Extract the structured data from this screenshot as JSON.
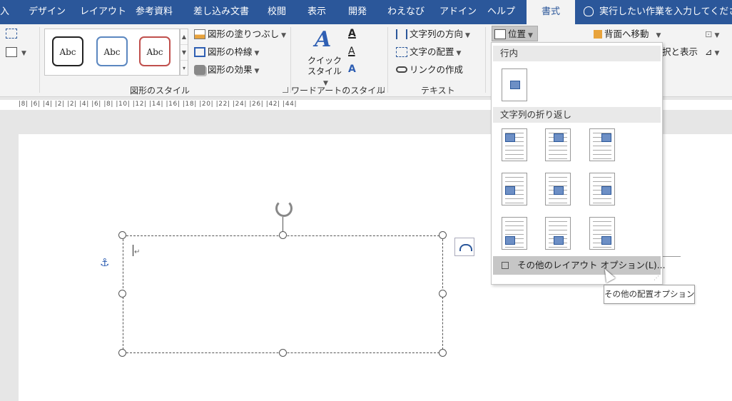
{
  "tabs": [
    {
      "label": "入"
    },
    {
      "label": "デザイン"
    },
    {
      "label": "レイアウト"
    },
    {
      "label": "参考資料"
    },
    {
      "label": "差し込み文書"
    },
    {
      "label": "校閲"
    },
    {
      "label": "表示"
    },
    {
      "label": "開発"
    },
    {
      "label": "わえなび"
    },
    {
      "label": "アドイン"
    },
    {
      "label": "ヘルプ"
    },
    {
      "label": "書式",
      "active": true
    }
  ],
  "tell_me": "実行したい作業を入力してください",
  "ribbon": {
    "shape_styles": {
      "samples": [
        "Abc",
        "Abc",
        "Abc"
      ],
      "fill": "図形の塗りつぶし",
      "outline": "図形の枠線",
      "effects": "図形の効果",
      "group_label": "図形のスタイル"
    },
    "wordart": {
      "quick_styles_line1": "クイック",
      "quick_styles_line2": "スタイル",
      "group_label": "ワードアートのスタイル"
    },
    "text": {
      "direction": "文字列の方向",
      "align": "文字の配置",
      "link": "リンクの作成",
      "group_label": "テキスト"
    },
    "arrange": {
      "position": "位置",
      "send_back": "背面へ移動",
      "selection_pane": "択と表示"
    }
  },
  "ruler_text": "|8|  |6|  |4|  |2|      |2|  |4|  |6|  |8|  |10|  |12|  |14|  |16|  |18|  |20|  |22|  |24|  |26|                                                               |42|  |44|",
  "position_menu": {
    "inline_heading": "行内",
    "wrap_heading": "文字列の折り返し",
    "more_options": "その他のレイアウト オプション(L)..."
  },
  "tooltip": "その他の配置オプション",
  "colors": {
    "tab_bar": "#2b579a",
    "ribbon": "#f3f3f3",
    "menu_highlight": "#c6c6c6"
  }
}
